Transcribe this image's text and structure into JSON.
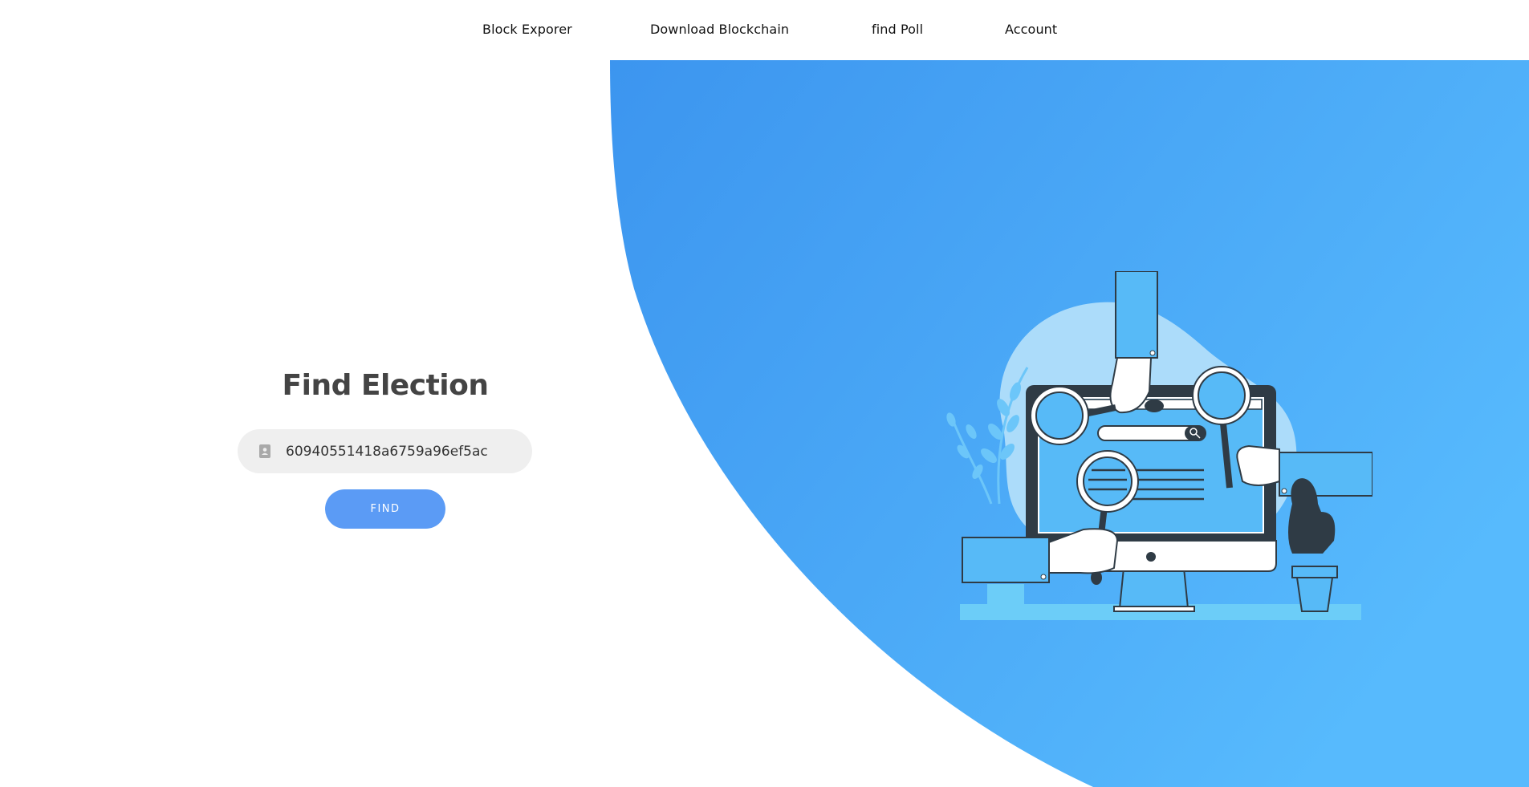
{
  "nav": {
    "items": [
      {
        "label": "Block Exporer"
      },
      {
        "label": "Download Blockchain"
      },
      {
        "label": "find Poll"
      },
      {
        "label": "Account"
      }
    ]
  },
  "form": {
    "title": "Find Election",
    "input_value": "60940551418a6759a96ef5ac",
    "input_icon": "id-card-icon",
    "button_label": "FIND"
  },
  "colors": {
    "accent": "#5b9bf5",
    "hero_blue_start": "#3c95ef",
    "hero_blue_end": "#57bafd",
    "title_text": "#444444",
    "input_bg": "#efefef"
  },
  "illustration": {
    "icon": "computer-search-illustration"
  }
}
